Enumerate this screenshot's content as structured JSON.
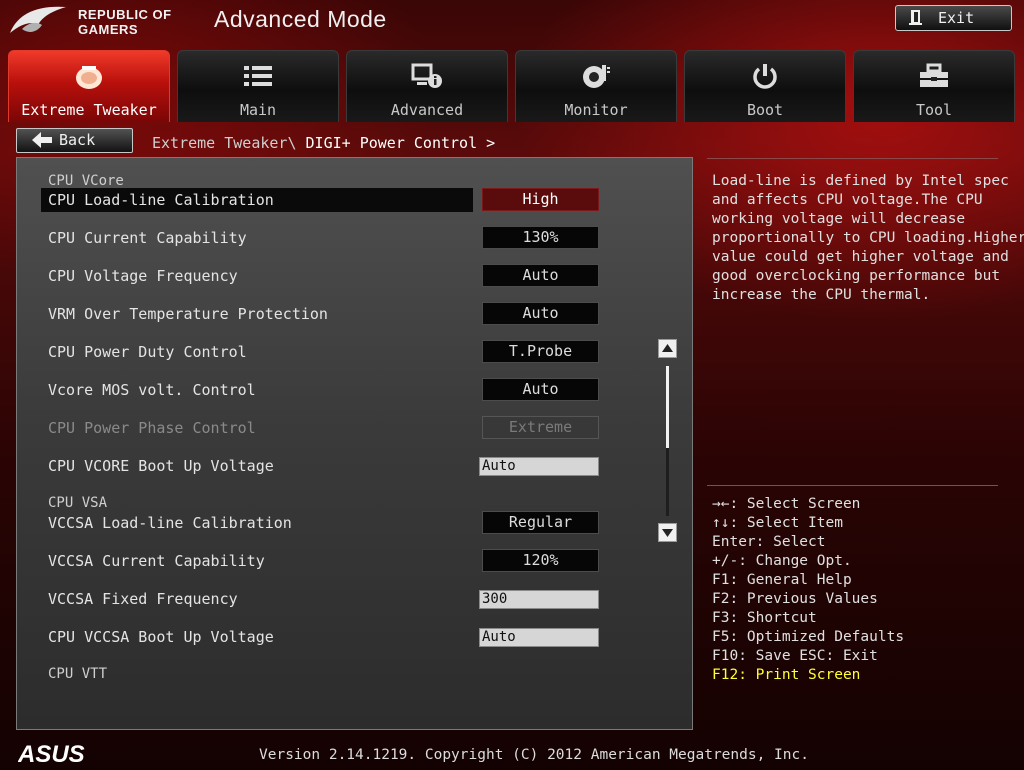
{
  "header": {
    "brand_line1": "REPUBLIC OF",
    "brand_line2": "GAMERS",
    "title": "Advanced Mode",
    "exit_label": "Exit"
  },
  "tabs": [
    {
      "label": "Extreme Tweaker",
      "icon": "speedometer-icon",
      "active": true
    },
    {
      "label": "Main",
      "icon": "list-icon",
      "active": false
    },
    {
      "label": "Advanced",
      "icon": "settings-info-icon",
      "active": false
    },
    {
      "label": "Monitor",
      "icon": "thermometer-icon",
      "active": false
    },
    {
      "label": "Boot",
      "icon": "power-icon",
      "active": false
    },
    {
      "label": "Tool",
      "icon": "toolbox-icon",
      "active": false
    }
  ],
  "nav": {
    "back_label": "Back",
    "breadcrumb_parent": "Extreme Tweaker\\ ",
    "breadcrumb_current": "DIGI+ Power Control >"
  },
  "settings": {
    "section_vcore": "CPU VCore",
    "section_vsa": "CPU VSA",
    "section_vtt": "CPU VTT",
    "rows": [
      {
        "label": "CPU Load-line Calibration",
        "value": "High",
        "kind": "button",
        "state": "selected"
      },
      {
        "label": "CPU Current Capability",
        "value": "130%",
        "kind": "button",
        "state": "normal"
      },
      {
        "label": "CPU Voltage Frequency",
        "value": "Auto",
        "kind": "button",
        "state": "normal"
      },
      {
        "label": "VRM Over Temperature Protection",
        "value": "Auto",
        "kind": "button",
        "state": "normal"
      },
      {
        "label": "CPU Power Duty Control",
        "value": "T.Probe",
        "kind": "button",
        "state": "normal"
      },
      {
        "label": "Vcore MOS volt. Control",
        "value": "Auto",
        "kind": "button",
        "state": "normal"
      },
      {
        "label": "CPU Power Phase Control",
        "value": "Extreme",
        "kind": "button",
        "state": "disabled"
      },
      {
        "label": "CPU VCORE Boot Up Voltage",
        "value": "Auto",
        "kind": "input",
        "state": "normal"
      },
      {
        "label": "VCCSA Load-line Calibration",
        "value": "Regular",
        "kind": "button",
        "state": "normal"
      },
      {
        "label": "VCCSA Current Capability",
        "value": "120%",
        "kind": "button",
        "state": "normal"
      },
      {
        "label": "VCCSA Fixed Frequency",
        "value": "300",
        "kind": "input",
        "state": "normal"
      },
      {
        "label": "CPU VCCSA Boot Up Voltage",
        "value": "Auto",
        "kind": "input",
        "state": "normal"
      }
    ]
  },
  "help": {
    "lines": [
      "Load-line is defined by Intel spec",
      "and affects CPU voltage.The CPU",
      "working voltage will decrease",
      "proportionally to CPU loading.Higher",
      "value could get higher voltage and",
      "good overclocking performance but",
      "increase the CPU thermal."
    ]
  },
  "keys": [
    "→←: Select Screen",
    "↑↓: Select Item",
    "Enter: Select",
    "+/-: Change Opt.",
    "F1: General Help",
    "F2: Previous Values",
    "F3: Shortcut",
    "F5: Optimized Defaults",
    "F10: Save  ESC: Exit",
    "F12: Print Screen"
  ],
  "footer": {
    "brand": "ASUS",
    "version": "Version 2.14.1219. Copyright (C) 2012 American Megatrends, Inc."
  },
  "colors": {
    "accent_red": "#c8140f",
    "selected_value": "#5a0c0c",
    "key_highlight": "#ffff33"
  }
}
